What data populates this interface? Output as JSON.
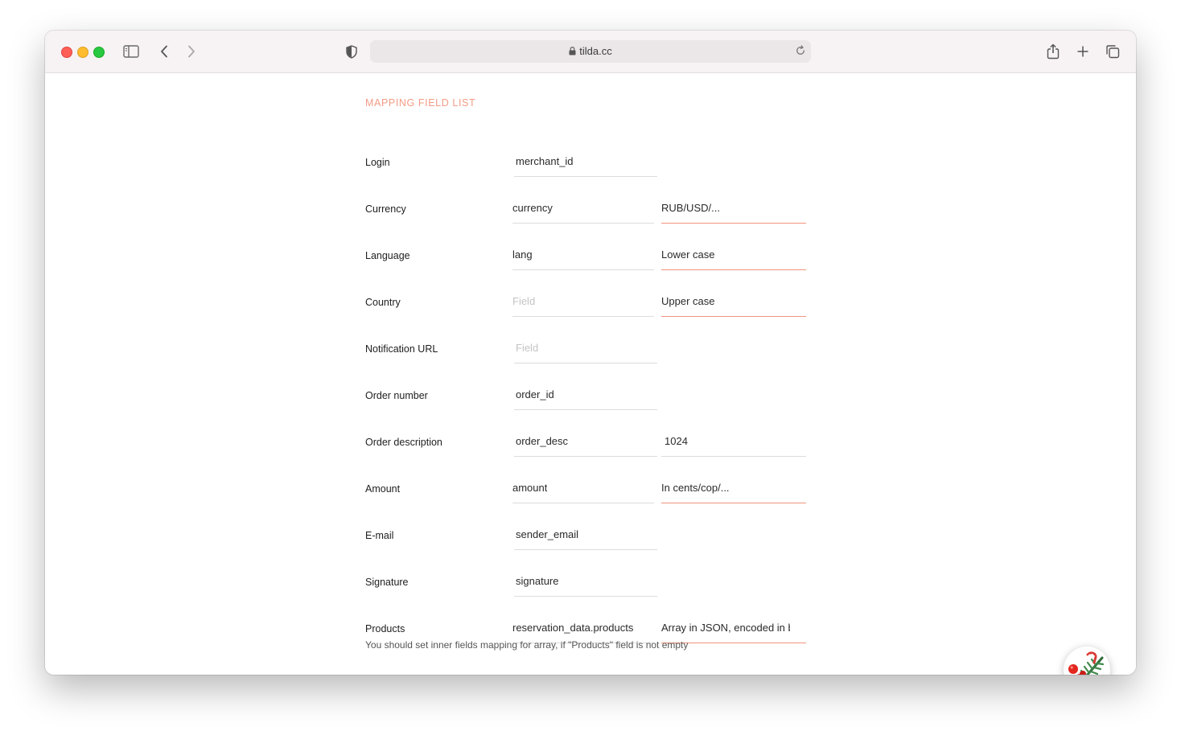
{
  "browser": {
    "url": "tilda.cc"
  },
  "page": {
    "section_title": "MAPPING FIELD LIST",
    "rows": [
      {
        "label": "Login",
        "field": "merchant_id",
        "field_placeholder": false,
        "note": null
      },
      {
        "label": "Currency",
        "field": "currency",
        "field_placeholder": false,
        "note": "RUB/USD/..."
      },
      {
        "label": "Language",
        "field": "lang",
        "field_placeholder": false,
        "note": "Lower case"
      },
      {
        "label": "Country",
        "field": "Field",
        "field_placeholder": true,
        "note": "Upper case"
      },
      {
        "label": "Notification URL",
        "field": "Field",
        "field_placeholder": true,
        "note": null
      },
      {
        "label": "Order number",
        "field": "order_id",
        "field_placeholder": false,
        "note": null
      },
      {
        "label": "Order description",
        "field": "order_desc",
        "field_placeholder": false,
        "note": "1024"
      },
      {
        "label": "Amount",
        "field": "amount",
        "field_placeholder": false,
        "note": "In cents/cop/..."
      },
      {
        "label": "E-mail",
        "field": "sender_email",
        "field_placeholder": false,
        "note": null
      },
      {
        "label": "Signature",
        "field": "signature",
        "field_placeholder": false,
        "note": null
      },
      {
        "label": "Products",
        "field": "reservation_data.products",
        "field_placeholder": false,
        "note": "Array in JSON, encoded in b"
      }
    ],
    "hint": "You should set inner fields mapping for array, if \"Products\" field is not empty"
  },
  "colors": {
    "accent": "#f49b86",
    "accent_underline": "#f0947d",
    "underline": "#dcdcdc"
  }
}
